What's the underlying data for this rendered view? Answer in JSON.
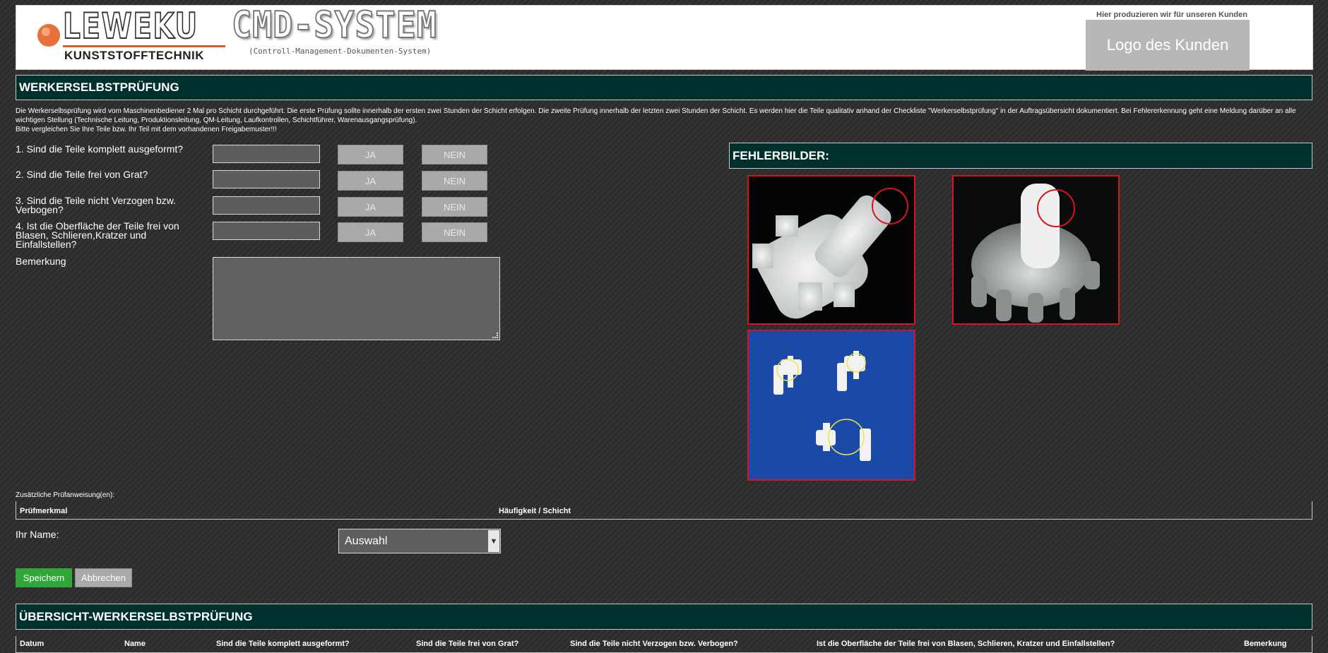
{
  "header": {
    "brand_name": "LEWEKU",
    "brand_sub": "KUNSTSTOFFTECHNIK",
    "system_title": "CMD-SYSTEM",
    "system_subtitle": "(Controll-Management-Dokumenten-System)",
    "customer_caption": "Hier produzieren wir für unseren Kunden",
    "customer_logo_text": "Logo des Kunden"
  },
  "section_title": "WERKERSELBSTPRÜFUNG",
  "intro_text": "Die Werkerselbsprüfung wird vom Maschinenbediener 2 Mal pro Schicht durchgeführt. Die erste Prüfung sollte innerhalb der ersten zwei Stunden der Schicht erfolgen. Die zweite Prüfung innerhalb der letzten zwei Stunden der Schicht. Es werden hier die Teile qualitativ anhand der Checkliste \"Werkerselbstprüfung\" in der Auftragsübersicht dokumentiert. Bei Fehlererkennung geht eine Meldung darüber an alle wichtigen Stellung (Technische Leitung, Produktionsleitung, QM-Leitung, Laufkontrollen, Schichtführer, Warenausgangsprüfung).",
  "intro_text_2": "Bitte vergleichen Sie Ihre Teile bzw. Ihr Teil mit dem vorhandenen Freigabemuster!!!",
  "questions": [
    {
      "label": "1. Sind die Teile komplett ausgeformt?",
      "yes": "JA",
      "no": "NEIN"
    },
    {
      "label": "2. Sind die Teile frei von Grat?",
      "yes": "JA",
      "no": "NEIN"
    },
    {
      "label": "3. Sind die Teile nicht Verzogen bzw. Verbogen?",
      "yes": "JA",
      "no": "NEIN"
    },
    {
      "label": "4. Ist die Oberfläche der Teile frei von Blasen, Schlieren,Kratzer und Einfallstellen?",
      "yes": "JA",
      "no": "NEIN"
    }
  ],
  "remark_label": "Bemerkung",
  "fehlerbilder_title": "FEHLERBILDER:",
  "additional": {
    "caption": "Zusätzliche Prüfanweisung(en):",
    "col1": "Prüfmerkmal",
    "col2": "Häufigkeit / Schicht"
  },
  "name_label": "Ihr Name:",
  "name_select_value": "Auswahl",
  "save_label": "Speichern",
  "cancel_label": "Abbrechen",
  "overview_title": "ÜBERSICHT-WERKERSELBSTPRÜFUNG",
  "overview_columns": [
    "Datum",
    "Name",
    "Sind die Teile komplett ausgeformt?",
    "Sind die Teile frei von Grat?",
    "Sind die Teile nicht Verzogen bzw. Verbogen?",
    "Ist die Oberfläche der Teile frei von Blasen, Schlieren, Kratzer und Einfallstellen?",
    "Bemerkung"
  ],
  "colors": {
    "section_bg": "#00302e",
    "save_green": "#2fa637",
    "defect_border": "#d4141f",
    "accent_orange": "#e05a2b"
  }
}
